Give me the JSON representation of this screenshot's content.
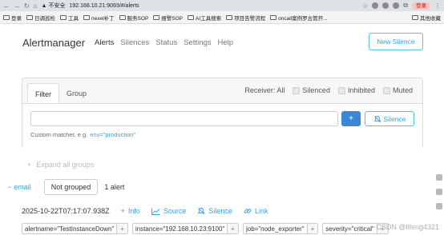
{
  "browser": {
    "insecure_label": "不安全",
    "url": "192.168.10.21:9093/#/alerts",
    "login_label": "登录"
  },
  "bookmarks": [
    "登录",
    "日调巡检",
    "工具",
    "nexel补丁",
    "服务SOP",
    "报警SOP",
    "AI工具搜索",
    "项目告警流程",
    "oncall案例罗古管开..."
  ],
  "bookmarks_right": "其他收藏",
  "navbar": {
    "brand": "Alertmanager",
    "links": [
      "Alerts",
      "Silences",
      "Status",
      "Settings",
      "Help"
    ],
    "new_silence": "New Silence"
  },
  "filter": {
    "tabs": [
      "Filter",
      "Group"
    ],
    "receiver_label": "Receiver: All",
    "checkboxes": [
      "Silenced",
      "Inhibited",
      "Muted"
    ],
    "input_value": "",
    "plus": "+",
    "silence_button": "Silence",
    "hint_prefix": "Custom matcher, e.g.",
    "hint_example": "env=\"production\""
  },
  "expand_all": "Expand all groups",
  "group": {
    "name": "email",
    "not_grouped": "Not grouped",
    "count": "1 alert"
  },
  "alert": {
    "timestamp": "2025-10-22T07:17:07.938Z",
    "actions": [
      "Info",
      "Source",
      "Silence",
      "Link"
    ],
    "labels": [
      "alertname=\"TestInstanceDown\"",
      "instance=\"192.168.10.23:9100\"",
      "job=\"node_exporter\"",
      "severity=\"critical\""
    ]
  },
  "watermark": "CSDN @lifeng4321",
  "colors": {
    "accent": "#2fa4e7",
    "primary_button": "#3a87d7"
  }
}
